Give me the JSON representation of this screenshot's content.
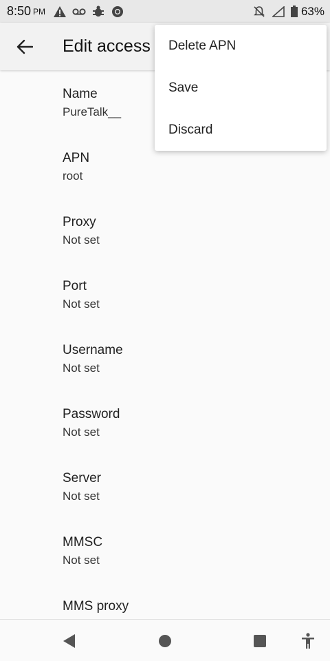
{
  "status_bar": {
    "time": "8:50",
    "ampm": "PM",
    "battery": "63%",
    "icons_left": [
      "warning-icon",
      "voicemail-icon",
      "bug-icon",
      "chrome-icon"
    ],
    "icons_right": [
      "notifications-off-icon",
      "signal-icon",
      "battery-icon"
    ]
  },
  "app_bar": {
    "title": "Edit access point"
  },
  "preferences": [
    {
      "title": "Name",
      "summary": "PureTalk__"
    },
    {
      "title": "APN",
      "summary": "root"
    },
    {
      "title": "Proxy",
      "summary": "Not set"
    },
    {
      "title": "Port",
      "summary": "Not set"
    },
    {
      "title": "Username",
      "summary": "Not set"
    },
    {
      "title": "Password",
      "summary": "Not set"
    },
    {
      "title": "Server",
      "summary": "Not set"
    },
    {
      "title": "MMSC",
      "summary": "Not set"
    },
    {
      "title": "MMS proxy",
      "summary": ""
    }
  ],
  "menu": {
    "items": [
      "Delete APN",
      "Save",
      "Discard"
    ]
  },
  "colors": {
    "status_bar_bg": "#e8e8e8",
    "app_bar_bg": "#f2f2f2",
    "background": "#fafafa",
    "menu_bg": "#ffffff"
  }
}
